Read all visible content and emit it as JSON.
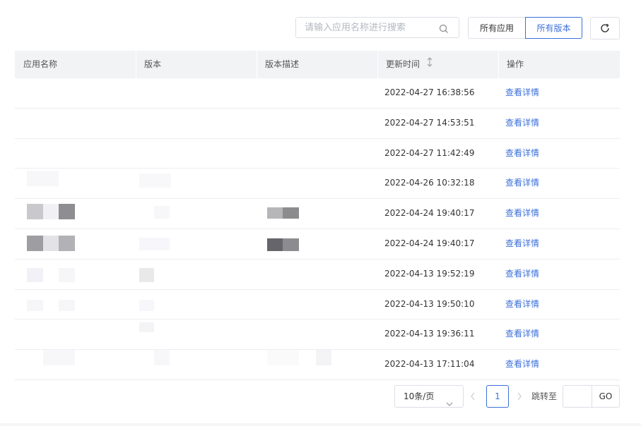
{
  "search": {
    "placeholder": "请输入应用名称进行搜索",
    "icon": "search-icon"
  },
  "filters": {
    "all_apps": "所有应用",
    "all_versions": "所有版本",
    "active": "all_versions",
    "accent": "#3b6fd9"
  },
  "refresh": {
    "icon": "refresh-icon"
  },
  "table": {
    "headers": [
      "应用名称",
      "版本",
      "版本描述",
      "更新时间",
      "操作"
    ],
    "rows": [
      {
        "time": "2022-04-27 16:38:56",
        "action": "查看详情"
      },
      {
        "time": "2022-04-27 14:53:51",
        "action": "查看详情"
      },
      {
        "time": "2022-04-27 11:42:49",
        "action": "查看详情"
      },
      {
        "time": "2022-04-26 10:32:18",
        "action": "查看详情"
      },
      {
        "time": "2022-04-24 19:40:17",
        "action": "查看详情"
      },
      {
        "time": "2022-04-24 19:40:17",
        "action": "查看详情"
      },
      {
        "time": "2022-04-13 19:52:19",
        "action": "查看详情"
      },
      {
        "time": "2022-04-13 19:50:10",
        "action": "查看详情"
      },
      {
        "time": "2022-04-13 19:36:11",
        "action": "查看详情"
      },
      {
        "time": "2022-04-13 17:11:04",
        "action": "查看详情"
      }
    ]
  },
  "pagination": {
    "page_size": "10条/页",
    "current_page": "1",
    "jump_label": "跳转至",
    "go": "GO"
  }
}
